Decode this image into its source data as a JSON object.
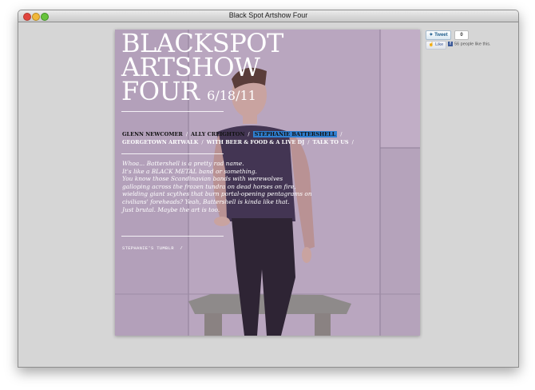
{
  "window": {
    "title": "Black Spot Artshow Four"
  },
  "hero": {
    "headline": [
      "BLACKSPOT",
      "ARTSHOW",
      "FOUR"
    ],
    "date": "6/18/11",
    "nav_artists": [
      "GLENN NEWCOMER",
      "ALLY CREIGHTON",
      "STEPHANIE BATTERSHELL"
    ],
    "nav_info": [
      "GEORGETOWN ARTWALK",
      "WITH BEER & FOOD & A LIVE DJ",
      "TALK TO US"
    ],
    "separator": "/",
    "blurb_lines": [
      "Whoa... Battershell is a pretty rad name.",
      "It's like a BLACK METAL band or something.",
      "You know those Scandinavian bands with werewolves",
      "galloping across the frozen tundra on dead horses on fire,",
      "wielding giant scythes that burn portal-opening pentagrams on",
      "civilians' foreheads? Yeah, Battershell is kinda like that.",
      "Just brutal. Maybe the art is too."
    ],
    "tumblr_link": "STEPHANIE'S TUMBLR",
    "highlight_color": "#2f7fd1"
  },
  "social": {
    "tweet_label": "Tweet",
    "tweet_count": "0",
    "like_label": "Like",
    "like_text": "56 people like this."
  }
}
